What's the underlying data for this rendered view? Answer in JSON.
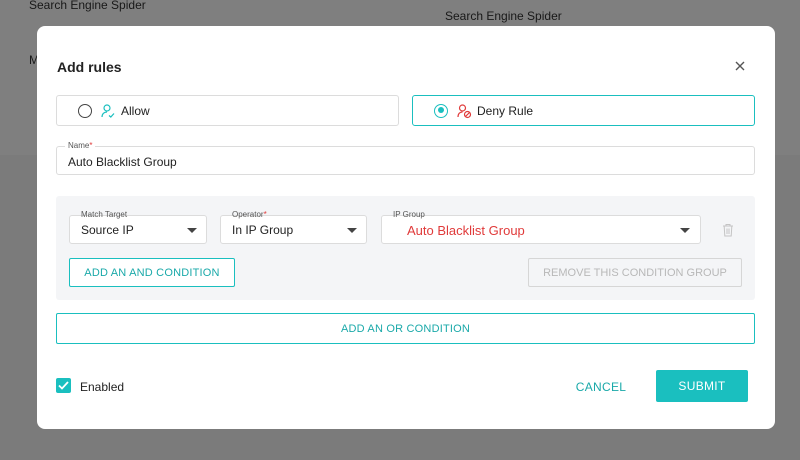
{
  "background": {
    "text_left_1": "Search Engine Spider",
    "text_right_1": "Search Engine Spider",
    "text_left_2": "M"
  },
  "modal": {
    "title": "Add rules",
    "radio_options": [
      {
        "label": "Allow",
        "selected": false
      },
      {
        "label": "Deny Rule",
        "selected": true
      }
    ],
    "name_field": {
      "label": "Name",
      "required_mark": "*",
      "value": "Auto Blacklist Group"
    },
    "condition_group": {
      "match_target": {
        "label": "Match Target",
        "value": "Source IP"
      },
      "operator": {
        "label": "Operator",
        "required_mark": "*",
        "value": "In IP Group"
      },
      "ip_group": {
        "label": "IP Group",
        "value": "Auto Blacklist Group",
        "value_color": "#e03a3a"
      },
      "add_and_label": "ADD AN AND CONDITION",
      "remove_group_label": "REMOVE THIS CONDITION GROUP"
    },
    "add_or_label": "ADD AN OR CONDITION",
    "enabled": {
      "label": "Enabled",
      "checked": true
    },
    "cancel_label": "CANCEL",
    "submit_label": "SUBMIT"
  },
  "colors": {
    "accent": "#1abfbf",
    "deny_icon": "#e03a3a",
    "allow_icon": "#1abfbf"
  }
}
